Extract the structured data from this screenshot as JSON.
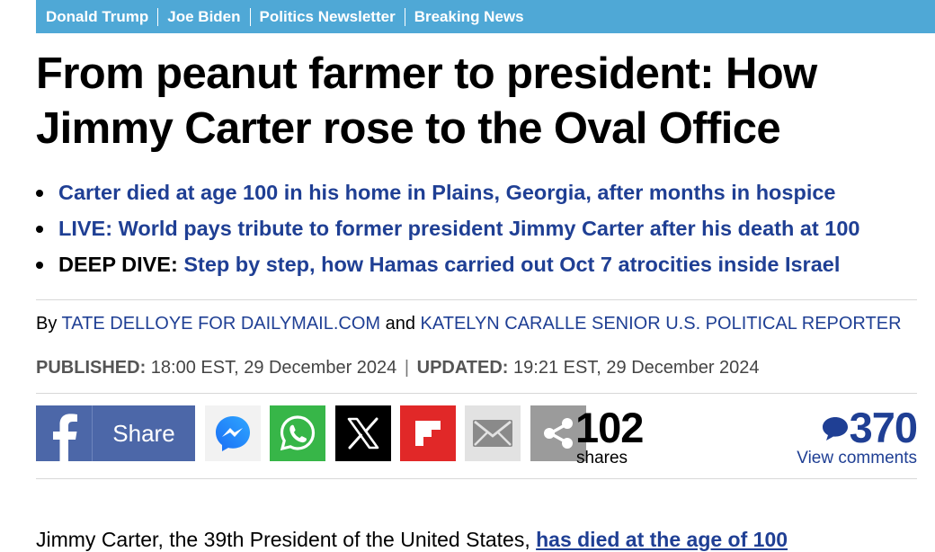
{
  "topnav": {
    "items": [
      "Donald Trump",
      "Joe Biden",
      "Politics Newsletter",
      "Breaking News"
    ]
  },
  "headline": "From peanut farmer to president: How Jimmy Carter rose to the Oval Office",
  "bullets": [
    {
      "prefix": "",
      "text": "Carter died at age 100 in his home in Plains, Georgia, after months in hospice"
    },
    {
      "prefix": "",
      "text": "LIVE: World pays tribute to former president Jimmy Carter after his death at 100"
    },
    {
      "prefix": "DEEP DIVE: ",
      "text": "Step by step, how Hamas carried out Oct 7 atrocities inside Israel"
    }
  ],
  "byline": {
    "by": "By ",
    "author1": "TATE DELLOYE FOR DAILYMAIL.COM",
    "and": " and ",
    "author2": "KATELYN CARALLE SENIOR U.S. POLITICAL REPORTER"
  },
  "dates": {
    "published_label": "PUBLISHED:",
    "published_value": " 18:00 EST, 29 December 2024 ",
    "separator": "|",
    "updated_label": " UPDATED:",
    "updated_value": " 19:21 EST, 29 December 2024"
  },
  "share": {
    "facebook_label": "Share",
    "buttons": [
      "facebook-icon",
      "messenger-icon",
      "whatsapp-icon",
      "x-icon",
      "flipboard-icon",
      "email-icon",
      "share-icon"
    ],
    "shares_count": "102",
    "shares_label": "shares",
    "comments_count": "370",
    "comments_label": "View comments"
  },
  "body": {
    "text_start": "Jimmy Carter, the 39th President of the United States, ",
    "link": "has died at the age of 100"
  },
  "colors": {
    "nav_bg": "#4fa8d6",
    "link": "#1f3f94",
    "facebook": "#4c67a8",
    "whatsapp": "#37b648",
    "flipboard": "#e12828",
    "x": "#000000",
    "email": "#e2e2e2",
    "share_generic": "#9b9b9b"
  }
}
